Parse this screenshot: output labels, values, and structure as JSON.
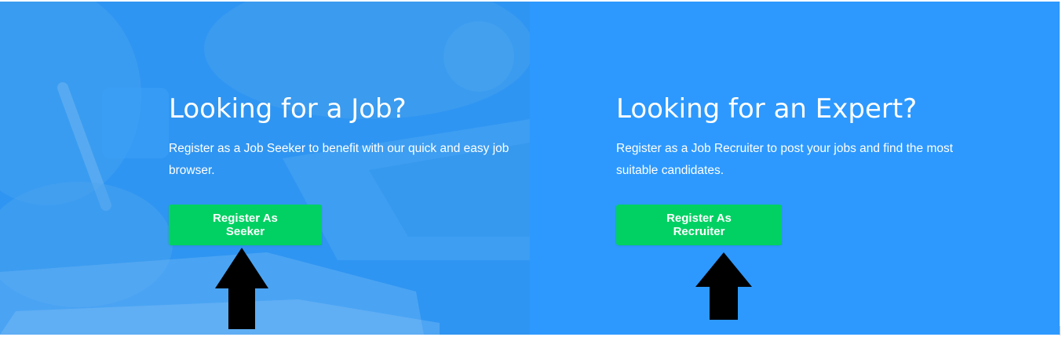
{
  "seeker": {
    "title": "Looking for a Job?",
    "description": "Register as a Job Seeker to benefit with our quick and easy job browser.",
    "button_label": "Register As Seeker"
  },
  "recruiter": {
    "title": "Looking for an Expert?",
    "description": "Register as a Job Recruiter to post your jobs and find the most suitable candidates.",
    "button_label": "Register As Recruiter"
  },
  "colors": {
    "panel_left": "#2f95f2",
    "panel_right": "#2d99ff",
    "button": "#00d162",
    "arrow": "#000000"
  },
  "icons": [
    "up-arrow-icon",
    "up-arrow-icon"
  ]
}
